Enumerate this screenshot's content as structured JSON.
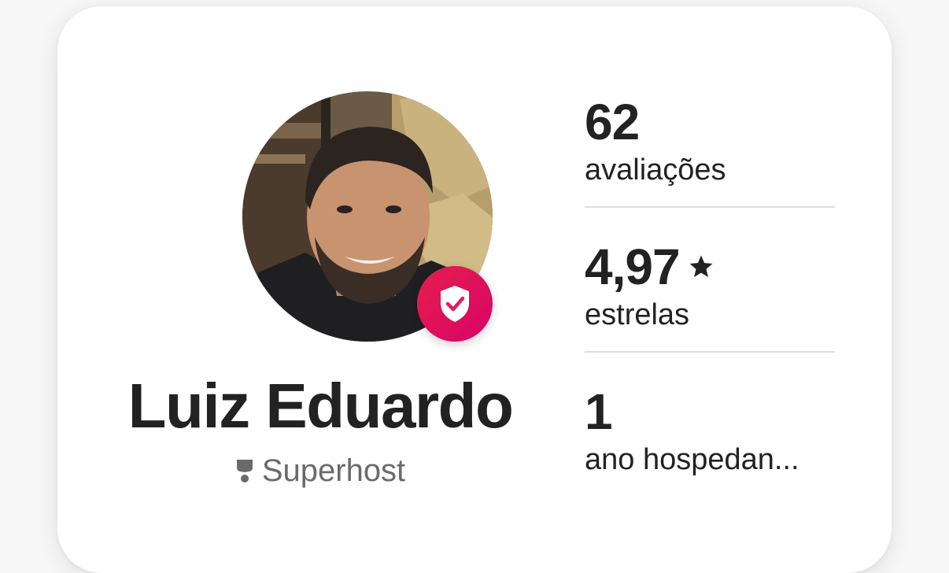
{
  "host": {
    "name": "Luiz Eduardo",
    "badge": "Superhost",
    "badge_icon": "superhost-ribbon-icon",
    "verified_icon": "shield-check-icon",
    "verified_color": "#E31C5F"
  },
  "stats": [
    {
      "value": "62",
      "label": "avaliações"
    },
    {
      "value": "4,97",
      "label": "estrelas",
      "icon": "star-icon"
    },
    {
      "value": "1",
      "label": "ano hospedan..."
    }
  ]
}
